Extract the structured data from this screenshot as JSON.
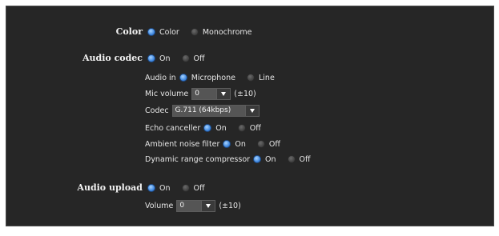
{
  "color": {
    "heading": "Color",
    "options": [
      {
        "label": "Color",
        "selected": true
      },
      {
        "label": "Monochrome",
        "selected": false
      }
    ]
  },
  "audio_codec": {
    "heading": "Audio codec",
    "options": [
      {
        "label": "On",
        "selected": true
      },
      {
        "label": "Off",
        "selected": false
      }
    ],
    "audio_in": {
      "label": "Audio in",
      "options": [
        {
          "label": "Microphone",
          "selected": true
        },
        {
          "label": "Line",
          "selected": false
        }
      ]
    },
    "mic_volume": {
      "label": "Mic volume",
      "value": "0",
      "range": "(±10)"
    },
    "codec": {
      "label": "Codec",
      "value": "G.711 (64kbps)"
    },
    "echo_canceller": {
      "label": "Echo canceller",
      "options": [
        {
          "label": "On",
          "selected": true
        },
        {
          "label": "Off",
          "selected": false
        }
      ]
    },
    "ambient_noise_filter": {
      "label": "Ambient noise filter",
      "options": [
        {
          "label": "On",
          "selected": true
        },
        {
          "label": "Off",
          "selected": false
        }
      ]
    },
    "dynamic_range_compressor": {
      "label": "Dynamic range compressor",
      "options": [
        {
          "label": "On",
          "selected": true
        },
        {
          "label": "Off",
          "selected": false
        }
      ]
    }
  },
  "audio_upload": {
    "heading": "Audio upload",
    "options": [
      {
        "label": "On",
        "selected": true
      },
      {
        "label": "Off",
        "selected": false
      }
    ],
    "volume": {
      "label": "Volume",
      "value": "0",
      "range": "(±10)"
    }
  },
  "colors": {
    "panel_background": "#262626",
    "radio_selected": "#3b84dd",
    "text": "#e6e6e6"
  }
}
